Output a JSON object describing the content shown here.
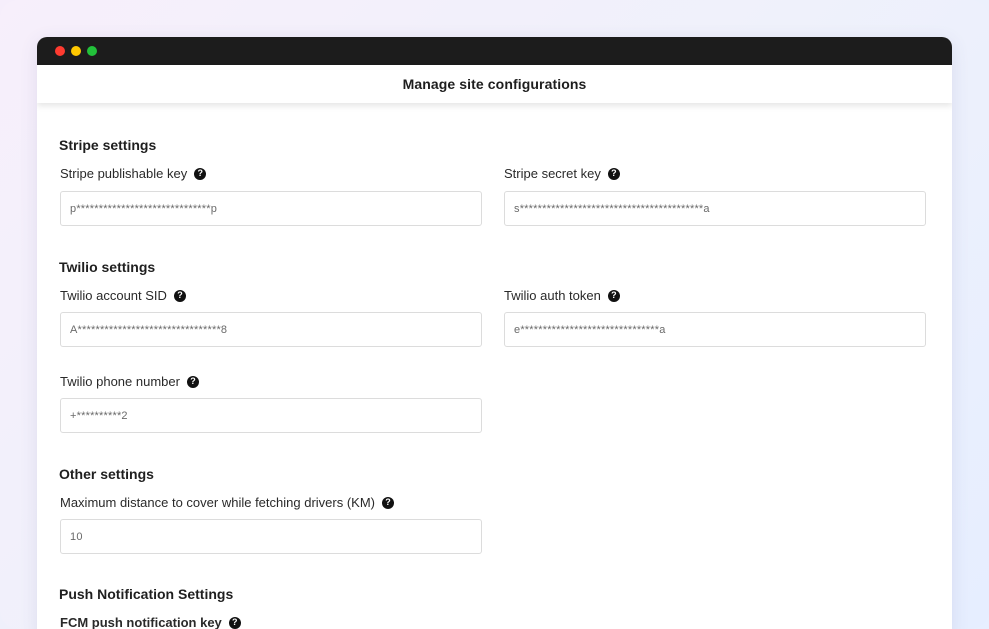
{
  "header": {
    "title": "Manage site configurations"
  },
  "sections": {
    "stripe": {
      "title": "Stripe settings",
      "publishable_key_label": "Stripe publishable key",
      "publishable_key_value": "p******************************p",
      "secret_key_label": "Stripe secret key",
      "secret_key_value": "s*****************************************a"
    },
    "twilio": {
      "title": "Twilio settings",
      "account_sid_label": "Twilio account SID",
      "account_sid_value": "A********************************8",
      "auth_token_label": "Twilio auth token",
      "auth_token_value": "e*******************************a",
      "phone_label": "Twilio phone number",
      "phone_value": "+**********2"
    },
    "other": {
      "title": "Other settings",
      "max_distance_label": "Maximum distance to cover while fetching drivers (KM)",
      "max_distance_value": "10"
    },
    "push": {
      "title": "Push Notification Settings",
      "fcm_key_label": "FCM push notification key"
    }
  },
  "icons": {
    "help": "question-circle-icon"
  },
  "colors": {
    "titlebar": "#1c1c1c",
    "close": "#ff3b30",
    "minimize": "#ffc800",
    "maximize": "#22c13a"
  }
}
